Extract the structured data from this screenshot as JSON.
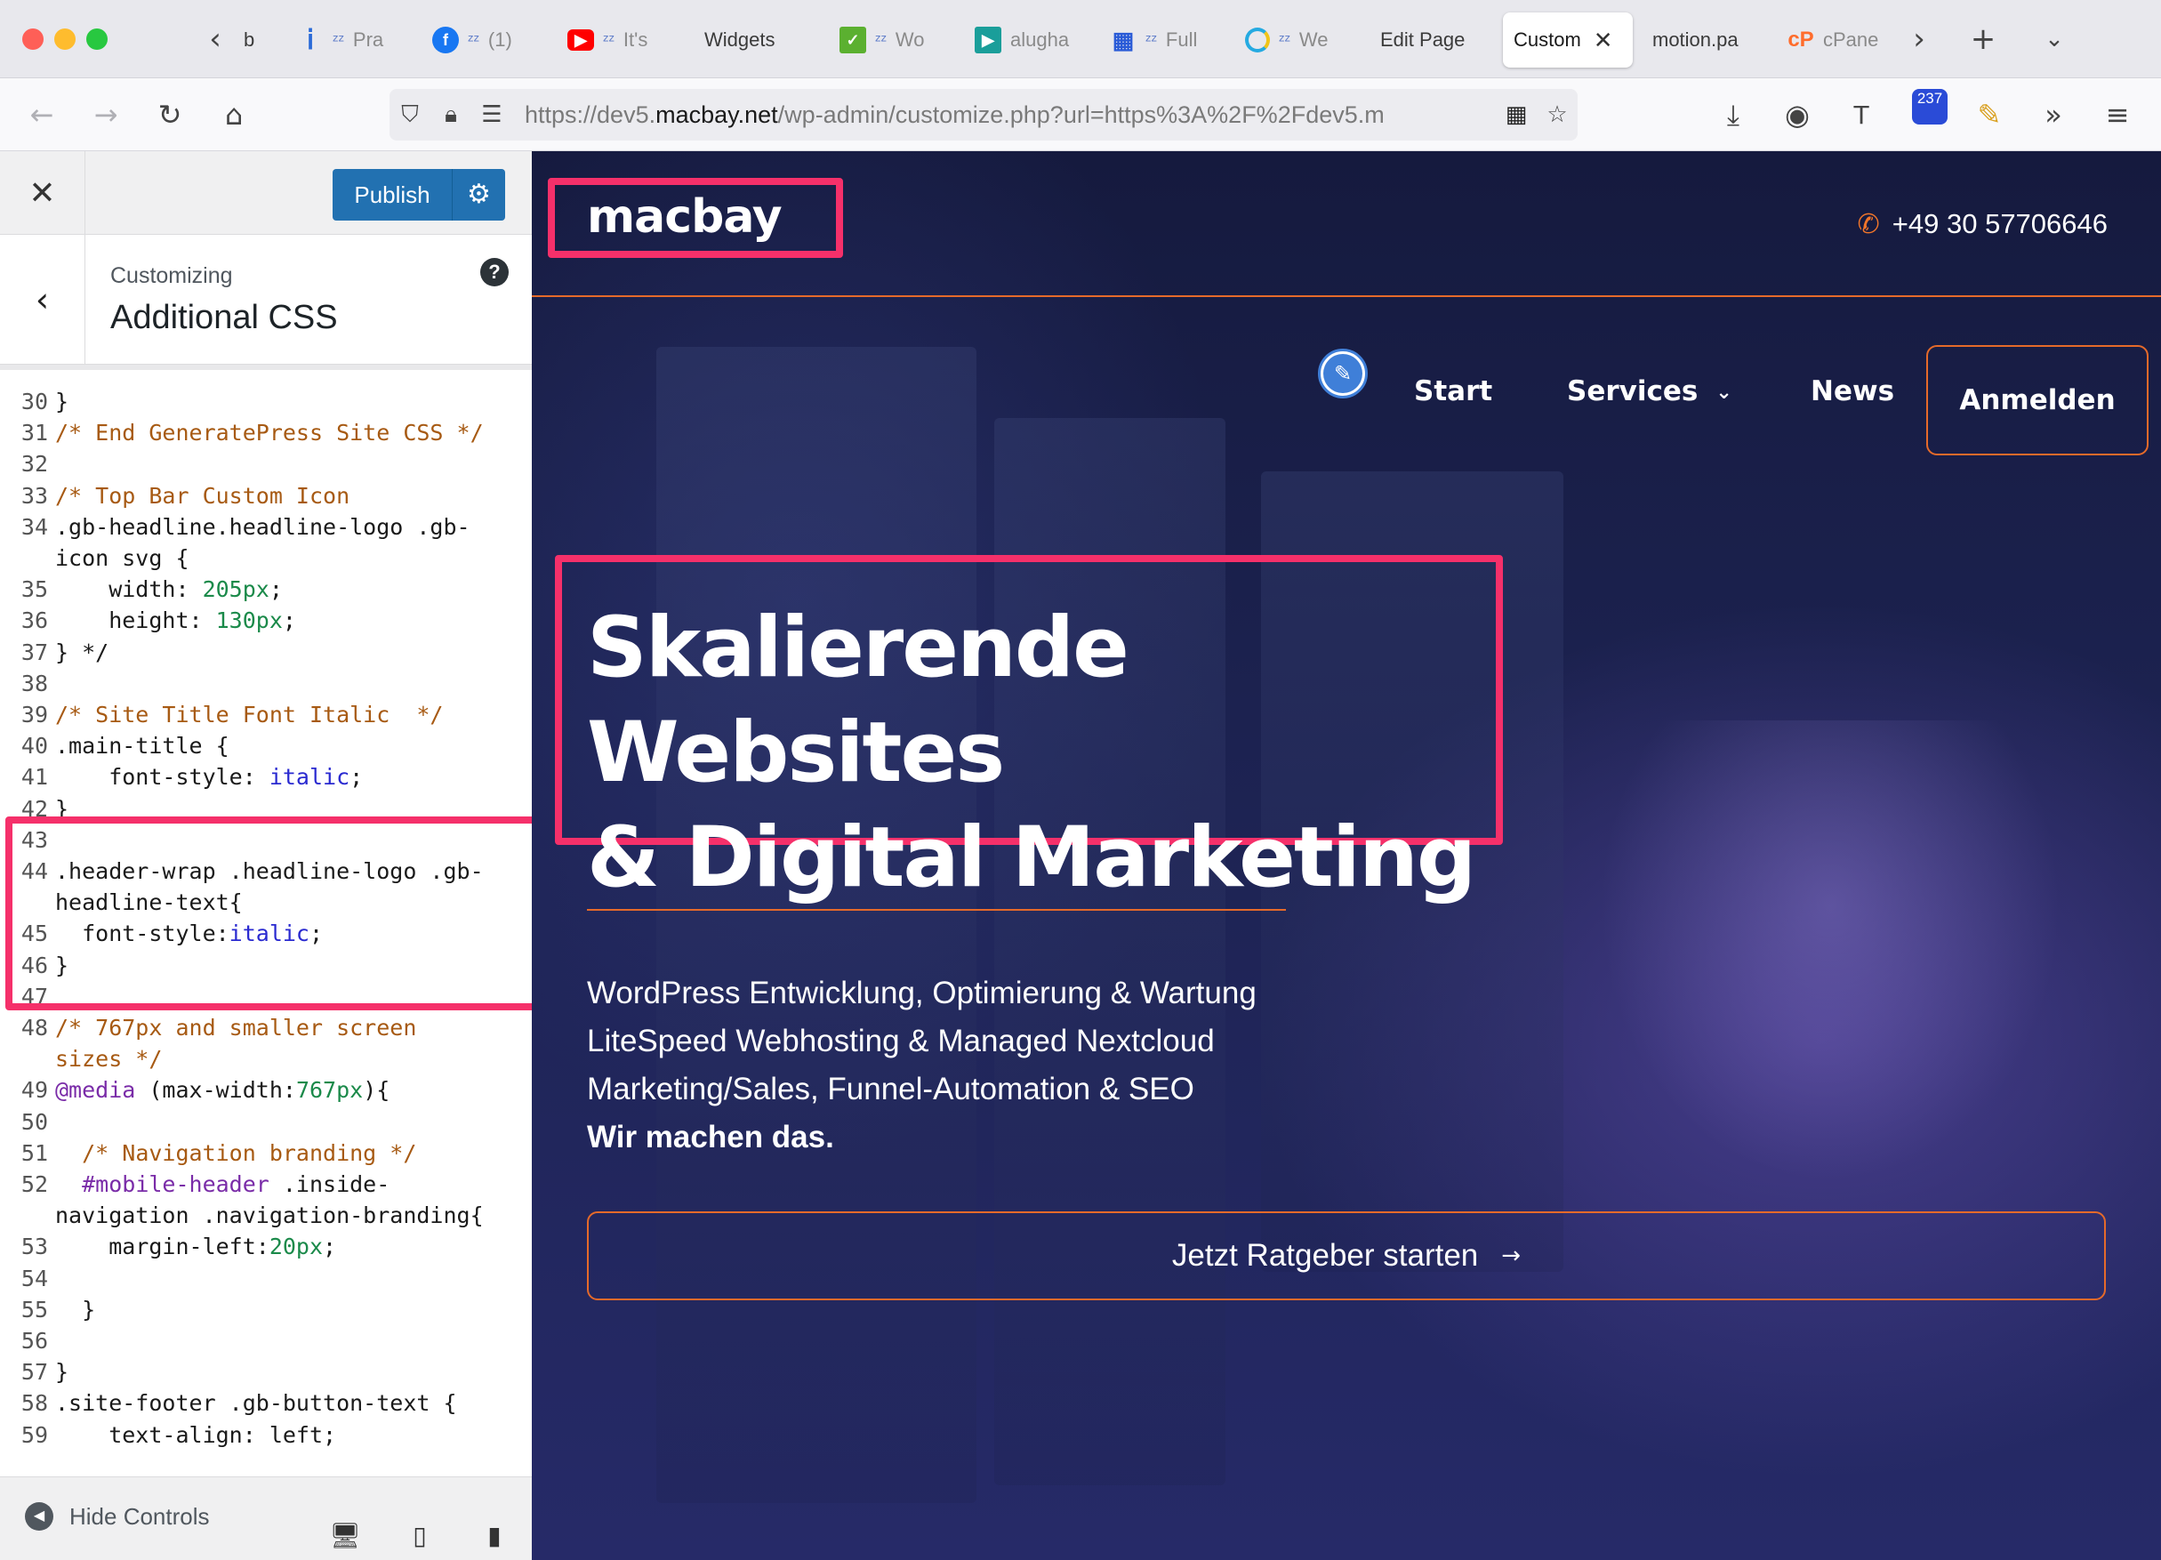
{
  "browser": {
    "tabs": [
      {
        "favicon": "page-icon",
        "label": "b",
        "snoozed": false
      },
      {
        "favicon": "info-icon",
        "label": "Pra",
        "snoozed": true
      },
      {
        "favicon": "facebook-icon",
        "label": "(1)",
        "snoozed": true
      },
      {
        "favicon": "youtube-icon",
        "label": "It's",
        "snoozed": true
      },
      {
        "favicon": "none",
        "label": "Widgets",
        "snoozed": false
      },
      {
        "favicon": "check-icon",
        "label": "Wo",
        "snoozed": true
      },
      {
        "favicon": "play-icon",
        "label": "alugha",
        "snoozed": false
      },
      {
        "favicon": "grid-icon",
        "label": "Full",
        "snoozed": true
      },
      {
        "favicon": "spinner-icon",
        "label": "We",
        "snoozed": true
      },
      {
        "favicon": "none",
        "label": "Edit Page",
        "snoozed": false
      },
      {
        "favicon": "none",
        "label": "Custom",
        "active": true
      },
      {
        "favicon": "none",
        "label": "motion.pa",
        "snoozed": false
      },
      {
        "favicon": "cpanel-icon",
        "label": "cPane",
        "snoozed": false
      }
    ],
    "url": {
      "prefix": "https://dev5.",
      "host": "macbay.net",
      "path": "/wp-admin/customize.php?url=https%3A%2F%2Fdev5.m"
    },
    "extension_badge": "237"
  },
  "customizer": {
    "publish_label": "Publish",
    "breadcrumb": "Customizing",
    "section_title": "Additional CSS",
    "hide_controls_label": "Hide Controls",
    "code_lines": [
      {
        "n": "30",
        "html": "}"
      },
      {
        "n": "31",
        "html": "<span class='cm'>/* End GeneratePress Site CSS */</span>"
      },
      {
        "n": "32",
        "html": ""
      },
      {
        "n": "33",
        "html": "<span class='cm'>/* Top Bar Custom Icon</span>"
      },
      {
        "n": "34",
        "html": ".gb-headline.headline-logo .gb-"
      },
      {
        "n": "",
        "html": "icon svg {"
      },
      {
        "n": "35",
        "html": "    width: <span class='nu'>205px</span>;"
      },
      {
        "n": "36",
        "html": "    height: <span class='nu'>130px</span>;"
      },
      {
        "n": "37",
        "html": "} */"
      },
      {
        "n": "38",
        "html": ""
      },
      {
        "n": "39",
        "html": "<span class='cm'>/* Site Title Font Italic  */</span>"
      },
      {
        "n": "40",
        "html": ".main-title {"
      },
      {
        "n": "41",
        "html": "    font-style: <span class='kw'>italic</span>;"
      },
      {
        "n": "42",
        "html": "}"
      },
      {
        "n": "43",
        "html": ""
      },
      {
        "n": "44",
        "html": ".header-wrap .headline-logo .gb-"
      },
      {
        "n": "",
        "html": "headline-text{"
      },
      {
        "n": "45",
        "html": "  font-style:<span class='kw'>italic</span>;"
      },
      {
        "n": "46",
        "html": "}"
      },
      {
        "n": "47",
        "html": ""
      },
      {
        "n": "48",
        "html": "<span class='cm'>/* 767px and smaller screen</span>"
      },
      {
        "n": "",
        "html": "<span class='cm'>sizes */</span>"
      },
      {
        "n": "49",
        "html": "<span class='at'>@media</span> (max-width:<span class='nu'>767px</span>){"
      },
      {
        "n": "50",
        "html": ""
      },
      {
        "n": "51",
        "html": "  <span class='cm'>/* Navigation branding */</span>"
      },
      {
        "n": "52",
        "html": "  <span class='at'>#mobile-header</span> .inside-"
      },
      {
        "n": "",
        "html": "navigation .navigation-branding{"
      },
      {
        "n": "53",
        "html": "    margin-left:<span class='nu'>20px</span>;"
      },
      {
        "n": "54",
        "html": ""
      },
      {
        "n": "55",
        "html": "  }"
      },
      {
        "n": "56",
        "html": ""
      },
      {
        "n": "57",
        "html": "}"
      },
      {
        "n": "58",
        "html": ".site-footer .gb-button-text {"
      },
      {
        "n": "59",
        "html": "    text-align: left;"
      }
    ]
  },
  "preview": {
    "logo": "macbay",
    "phone": "+49 30 57706646",
    "menu": {
      "start": "Start",
      "services": "Services",
      "news": "News",
      "login": "Anmelden"
    },
    "hero_title_line1": "Skalierende Websites",
    "hero_title_line2": "& Digital Marketing",
    "hero_lines": [
      "WordPress Entwicklung, Optimierung & Wartung",
      "LiteSpeed Webhosting & Managed Nextcloud",
      "Marketing/Sales, Funnel-Automation & SEO"
    ],
    "hero_strong": "Wir machen das.",
    "cta_label": "Jetzt Ratgeber starten"
  },
  "colors": {
    "highlight": "#f5306a",
    "accent_orange": "#e56a2a",
    "wp_blue": "#2271b1",
    "preview_bg": "#1c2250"
  }
}
